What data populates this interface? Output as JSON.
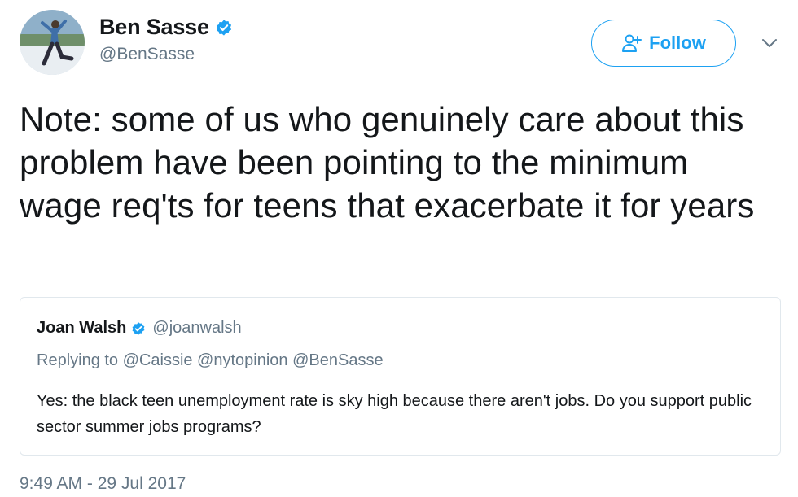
{
  "author": {
    "name": "Ben Sasse",
    "handle": "@BenSasse",
    "verified": true
  },
  "actions": {
    "follow_label": "Follow"
  },
  "tweet": {
    "text": "Note: some of us who genuinely care about this problem have been pointing to the minimum wage req'ts for teens that exacerbate it for years",
    "timestamp": "9:49 AM - 29 Jul 2017"
  },
  "quoted_tweet": {
    "name": "Joan Walsh",
    "handle": "@joanwalsh",
    "verified": true,
    "replying_to_label": "Replying to",
    "replying_to": "@Caissie @nytopinion @BenSasse",
    "text": "Yes: the black teen unemployment rate is sky high because there aren't jobs. Do you support public sector summer jobs programs?"
  },
  "colors": {
    "accent": "#1da1f2",
    "secondary_text": "#657786",
    "primary_text": "#14171a",
    "border": "#e1e8ed"
  },
  "icons": {
    "verified": "verified-badge-icon",
    "follow": "add-person-icon",
    "menu": "chevron-down-icon"
  }
}
